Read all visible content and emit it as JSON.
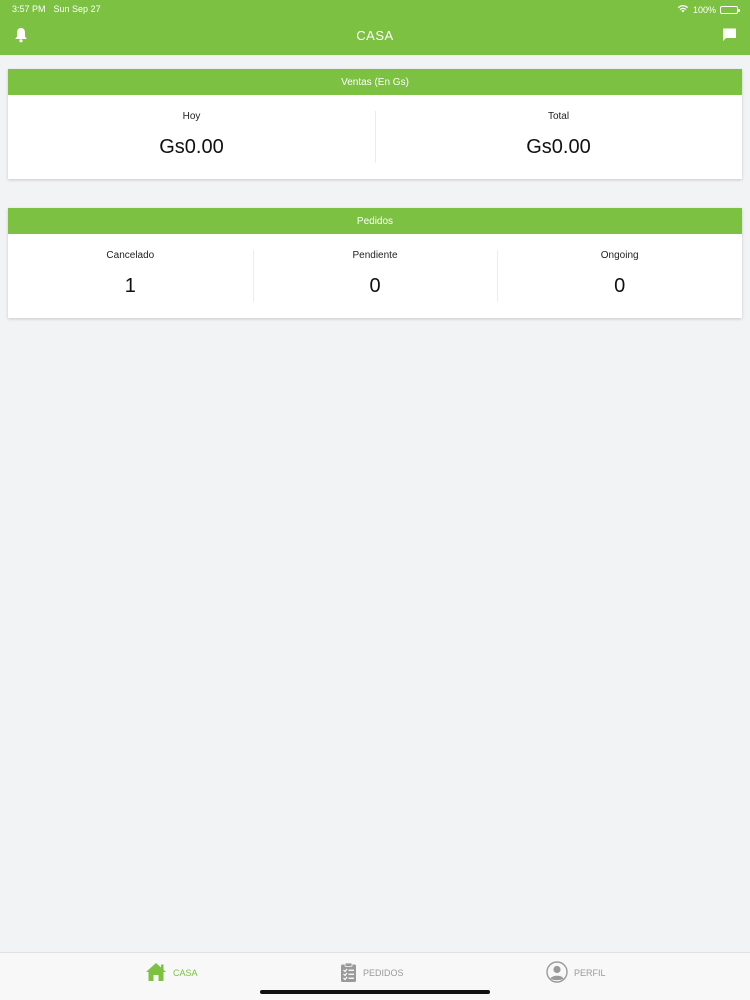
{
  "status_bar": {
    "time": "3:57 PM",
    "date": "Sun Sep 27",
    "battery": "100%",
    "icons": [
      "wifi-icon",
      "battery-icon"
    ]
  },
  "nav": {
    "title": "CASA",
    "left_icon": "bell-icon",
    "right_icon": "chat-icon"
  },
  "ventas": {
    "header": "Ventas (En Gs)",
    "stats": [
      {
        "label": "Hoy",
        "value": "Gs0.00"
      },
      {
        "label": "Total",
        "value": "Gs0.00"
      }
    ]
  },
  "pedidos": {
    "header": "Pedidos",
    "stats": [
      {
        "label": "Cancelado",
        "value": "1"
      },
      {
        "label": "Pendiente",
        "value": "0"
      },
      {
        "label": "Ongoing",
        "value": "0"
      }
    ]
  },
  "tabs": [
    {
      "label": "CASA",
      "icon": "home-icon",
      "active": true
    },
    {
      "label": "PEDIDOS",
      "icon": "clipboard-list-icon",
      "active": false
    },
    {
      "label": "PERFIL",
      "icon": "user-circle-icon",
      "active": false
    }
  ],
  "colors": {
    "primary": "#7dc142",
    "background": "#f2f3f5",
    "inactive": "#9a9a9a"
  }
}
